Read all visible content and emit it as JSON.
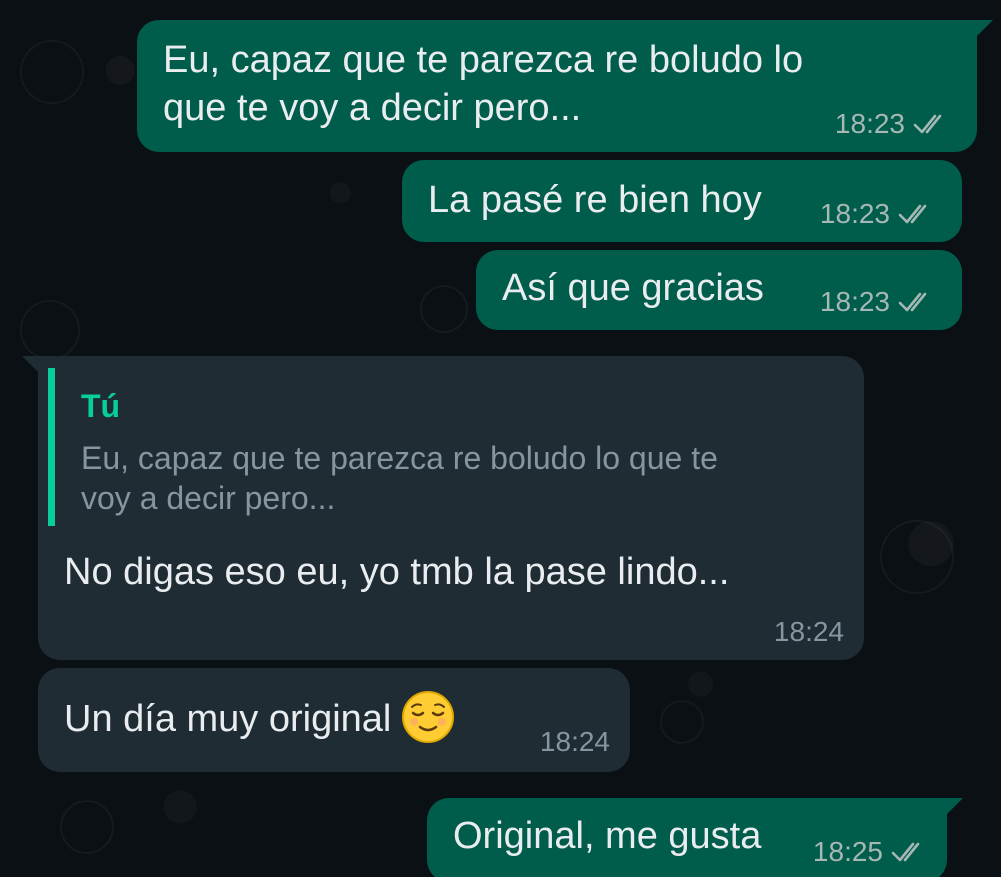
{
  "messages": [
    {
      "direction": "outgoing",
      "lines": [
        "Eu, capaz que te parezca re boludo lo",
        "que te voy a decir pero..."
      ],
      "time": "18:23",
      "status": "read-double-check-icon"
    },
    {
      "direction": "outgoing",
      "text": "La pasé re bien hoy",
      "time": "18:23",
      "status": "read-double-check-icon"
    },
    {
      "direction": "outgoing",
      "text": "Así que gracias",
      "time": "18:23",
      "status": "read-double-check-icon"
    },
    {
      "direction": "incoming",
      "reply_to": {
        "author": "Tú",
        "lines": [
          "Eu, capaz que te parezca re boludo lo que te",
          "voy a decir pero..."
        ]
      },
      "text": "No digas eso eu,  yo tmb la pase lindo...",
      "time": "18:24"
    },
    {
      "direction": "incoming",
      "text": "Un día muy original",
      "emoji": "relieved-face-emoji",
      "time": "18:24"
    },
    {
      "direction": "outgoing",
      "text": "Original, me gusta",
      "time": "18:25",
      "status": "read-double-check-icon"
    }
  ],
  "colors": {
    "background": "#0b1014",
    "outgoing_bubble": "#005c4b",
    "incoming_bubble": "#1f2c34",
    "reply_accent": "#06cf9c",
    "text": "#e9edef",
    "meta_text": "#8696a0"
  }
}
